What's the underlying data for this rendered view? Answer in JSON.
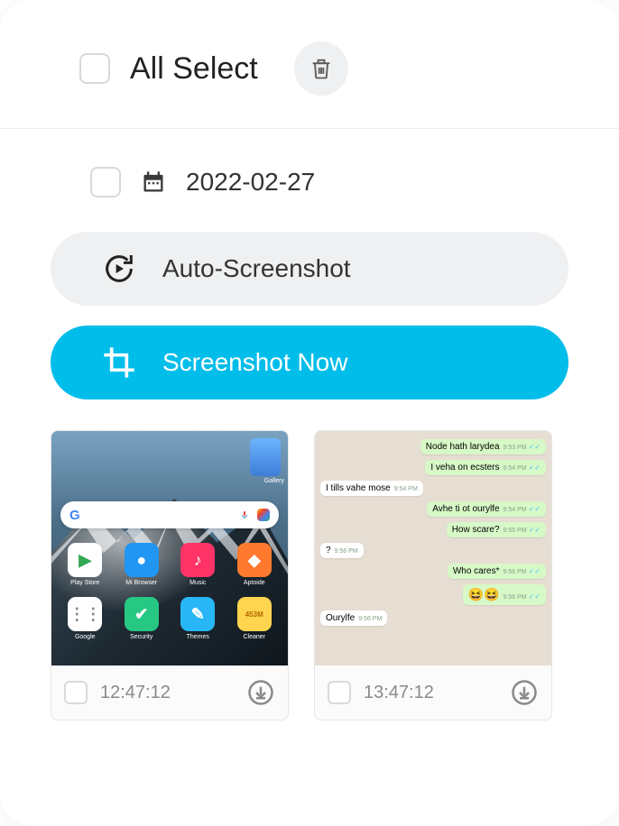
{
  "topbar": {
    "all_select_label": "All Select"
  },
  "date_group": {
    "date": "2022-02-27"
  },
  "actions": {
    "auto_label": "Auto-Screenshot",
    "now_label": "Screenshot Now"
  },
  "homescreen": {
    "gallery_label": "Gallery",
    "apps": [
      {
        "name": "Play Store",
        "bg": "#ffffff",
        "glyph": "▶",
        "glyphColor": "#34a853"
      },
      {
        "name": "Mi Browser",
        "bg": "#2196f3",
        "glyph": "●",
        "glyphColor": "#ffffff"
      },
      {
        "name": "Music",
        "bg": "#ff3366",
        "glyph": "♪",
        "glyphColor": "#ffffff"
      },
      {
        "name": "Aptoide",
        "bg": "#ff7a2f",
        "glyph": "◆",
        "glyphColor": "#ffffff"
      },
      {
        "name": "Google",
        "bg": "#ffffff",
        "glyph": "⋮⋮",
        "glyphColor": "#888"
      },
      {
        "name": "Security",
        "bg": "#27c884",
        "glyph": "✔",
        "glyphColor": "#ffffff"
      },
      {
        "name": "Themes",
        "bg": "#29b6f6",
        "glyph": "✎",
        "glyphColor": "#ffffff"
      },
      {
        "name": "Cleaner",
        "bg": "#ffd54f",
        "glyph": "453M",
        "glyphColor": "#b26a00"
      }
    ]
  },
  "chat": {
    "messages": [
      {
        "side": "out",
        "text": "Node hath larydea",
        "time": "9:53 PM",
        "ticks": true
      },
      {
        "side": "out",
        "text": "I veha on ecsters",
        "time": "9:54 PM",
        "ticks": true
      },
      {
        "side": "in",
        "text": "I tills vahe mose",
        "time": "9:54 PM"
      },
      {
        "side": "out",
        "text": "Avhe ti ot ourylfe",
        "time": "9:54 PM",
        "ticks": true
      },
      {
        "side": "out",
        "text": "How scare?",
        "time": "9:55 PM",
        "ticks": true
      },
      {
        "side": "in",
        "text": "?",
        "time": "9:56 PM"
      },
      {
        "side": "out",
        "text": "Who cares*",
        "time": "9:56 PM",
        "ticks": true
      },
      {
        "side": "out",
        "text": "😆😆",
        "time": "9:56 PM",
        "ticks": true,
        "emoji": true
      },
      {
        "side": "in",
        "text": "Ourylfe",
        "time": "9:56 PM"
      }
    ]
  },
  "thumbs": [
    {
      "time": "12:47:12"
    },
    {
      "time": "13:47:12"
    }
  ]
}
